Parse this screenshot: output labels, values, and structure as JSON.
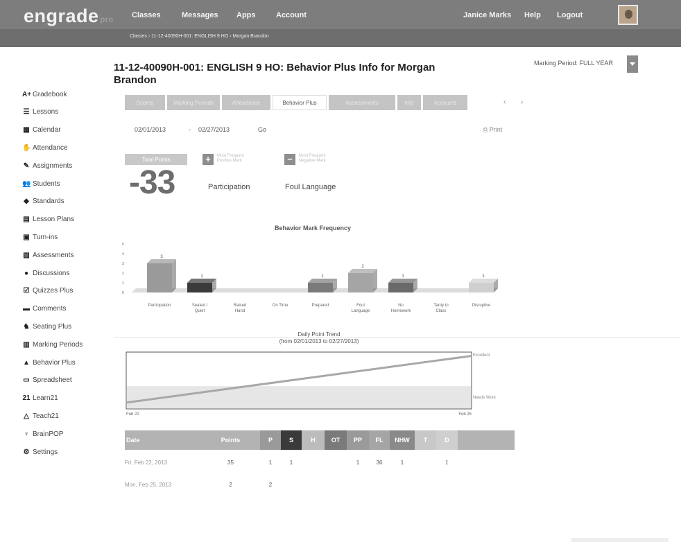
{
  "app": {
    "logo": "engrade",
    "logo_suffix": "pro"
  },
  "nav": {
    "classes": "Classes",
    "messages": "Messages",
    "apps": "Apps",
    "account": "Account",
    "user": "Janice Marks",
    "help": "Help",
    "logout": "Logout"
  },
  "breadcrumb": "Classes › 11-12-40090H-001: ENGLISH 9 HO › Morgan Brandon",
  "page": {
    "title": "11-12-40090H-001: ENGLISH 9 HO: Behavior Plus Info for Morgan Brandon",
    "marking_period": "Marking Period: FULL YEAR"
  },
  "sidebar": [
    {
      "icon": "A+",
      "icon_name": "gradebook-icon",
      "label": "Gradebook"
    },
    {
      "icon": "☰",
      "icon_name": "lessons-icon",
      "label": "Lessons"
    },
    {
      "icon": "▦",
      "icon_name": "calendar-icon",
      "label": "Calendar"
    },
    {
      "icon": "✋",
      "icon_name": "attendance-icon",
      "label": "Attendance"
    },
    {
      "icon": "✎",
      "icon_name": "assignments-icon",
      "label": "Assignments"
    },
    {
      "icon": "👥",
      "icon_name": "students-icon",
      "label": "Students"
    },
    {
      "icon": "◆",
      "icon_name": "standards-icon",
      "label": "Standards"
    },
    {
      "icon": "▤",
      "icon_name": "lesson-plans-icon",
      "label": "Lesson Plans"
    },
    {
      "icon": "▣",
      "icon_name": "turn-ins-icon",
      "label": "Turn-ins"
    },
    {
      "icon": "▧",
      "icon_name": "assessments-icon",
      "label": "Assessments"
    },
    {
      "icon": "●",
      "icon_name": "discussions-icon",
      "label": "Discussions"
    },
    {
      "icon": "☑",
      "icon_name": "quizzes-plus-icon",
      "label": "Quizzes Plus"
    },
    {
      "icon": "▬",
      "icon_name": "comments-icon",
      "label": "Comments"
    },
    {
      "icon": "♞",
      "icon_name": "seating-plus-icon",
      "label": "Seating Plus"
    },
    {
      "icon": "▥",
      "icon_name": "marking-periods-icon",
      "label": "Marking Periods"
    },
    {
      "icon": "▲",
      "icon_name": "behavior-plus-icon",
      "label": "Behavior Plus"
    },
    {
      "icon": "▭",
      "icon_name": "spreadsheet-icon",
      "label": "Spreadsheet"
    },
    {
      "icon": "21",
      "icon_name": "learn21-icon",
      "label": "Learn21"
    },
    {
      "icon": "△",
      "icon_name": "teach21-icon",
      "label": "Teach21"
    },
    {
      "icon": "♀",
      "icon_name": "brainpop-icon",
      "label": "BrainPOP"
    },
    {
      "icon": "⚙",
      "icon_name": "settings-icon",
      "label": "Settings"
    }
  ],
  "tabs": [
    {
      "label": "Scores",
      "active": false
    },
    {
      "label": "Marking Periods",
      "active": false
    },
    {
      "label": "Attendance",
      "active": false
    },
    {
      "label": "Behavior Plus",
      "active": true
    },
    {
      "label": "Assessments",
      "active": false
    },
    {
      "label": "Info",
      "active": false
    },
    {
      "label": "Accounts",
      "active": false
    }
  ],
  "tab_nav": {
    "prev": "‹",
    "next": "›"
  },
  "filters": {
    "start_date": "02/01/2013",
    "separator": "-",
    "end_date": "02/27/2013",
    "go": "Go",
    "print": "Print"
  },
  "summary": {
    "total_points_label": "Total Points",
    "total_points": "-33",
    "positive_label": "Most Frequent Positive Mark",
    "positive_value": "Participation",
    "negative_label": "Most Frequent Negative Mark",
    "negative_value": "Foul Language"
  },
  "colors": {
    "topbar": "#7d7d7d",
    "tab": "#c4c4c4",
    "table_header": "#b3b3b3"
  },
  "chart_data": [
    {
      "type": "bar",
      "title": "Behavior Mark Frequency",
      "categories": [
        "Participation",
        "Seated / Quiet",
        "Raised Hand",
        "On Time",
        "Prepared",
        "Foul Language",
        "No Homework",
        "Tardy to Class",
        "Disruptive"
      ],
      "values": [
        3,
        1,
        0,
        0,
        1,
        2,
        1,
        0,
        1
      ],
      "colors": [
        "#9a9a9a",
        "#3a3a3a",
        "#c0c0c0",
        "#c0c0c0",
        "#7a7a7a",
        "#a5a5a5",
        "#6a6a6a",
        "#c8c8c8",
        "#cfcfcf"
      ],
      "ylim": [
        0,
        5
      ]
    },
    {
      "type": "line",
      "title": "Daily Point Trend",
      "subtitle": "(from 02/01/2013 to 02/27/2013)",
      "x": [
        "Feb 22",
        "Feb 25"
      ],
      "series": [
        {
          "values": [
            -35,
            2
          ]
        }
      ],
      "bands": [
        {
          "label": "Excellent"
        },
        {
          "label": "Needs Work"
        }
      ]
    }
  ],
  "table": {
    "headers": [
      "Date",
      "Points",
      "P",
      "S",
      "H",
      "OT",
      "PP",
      "FL",
      "NHW",
      "T",
      "D"
    ],
    "header_colors": [
      "#b3b3b3",
      "#b3b3b3",
      "#9a9a9a",
      "#3a3a3a",
      "#bcbcbc",
      "#7a7a7a",
      "#9a9a9a",
      "#a5a5a5",
      "#8a8a8a",
      "#c8c8c8",
      "#cfcfcf"
    ],
    "rows": [
      [
        "Fri, Feb 22, 2013",
        "35",
        "1",
        "1",
        "",
        "",
        "1",
        "36",
        "1",
        "",
        "1"
      ],
      [
        "Mon, Feb 25, 2013",
        "2",
        "2",
        "",
        "",
        "",
        "",
        "",
        "",
        "",
        ""
      ]
    ]
  }
}
